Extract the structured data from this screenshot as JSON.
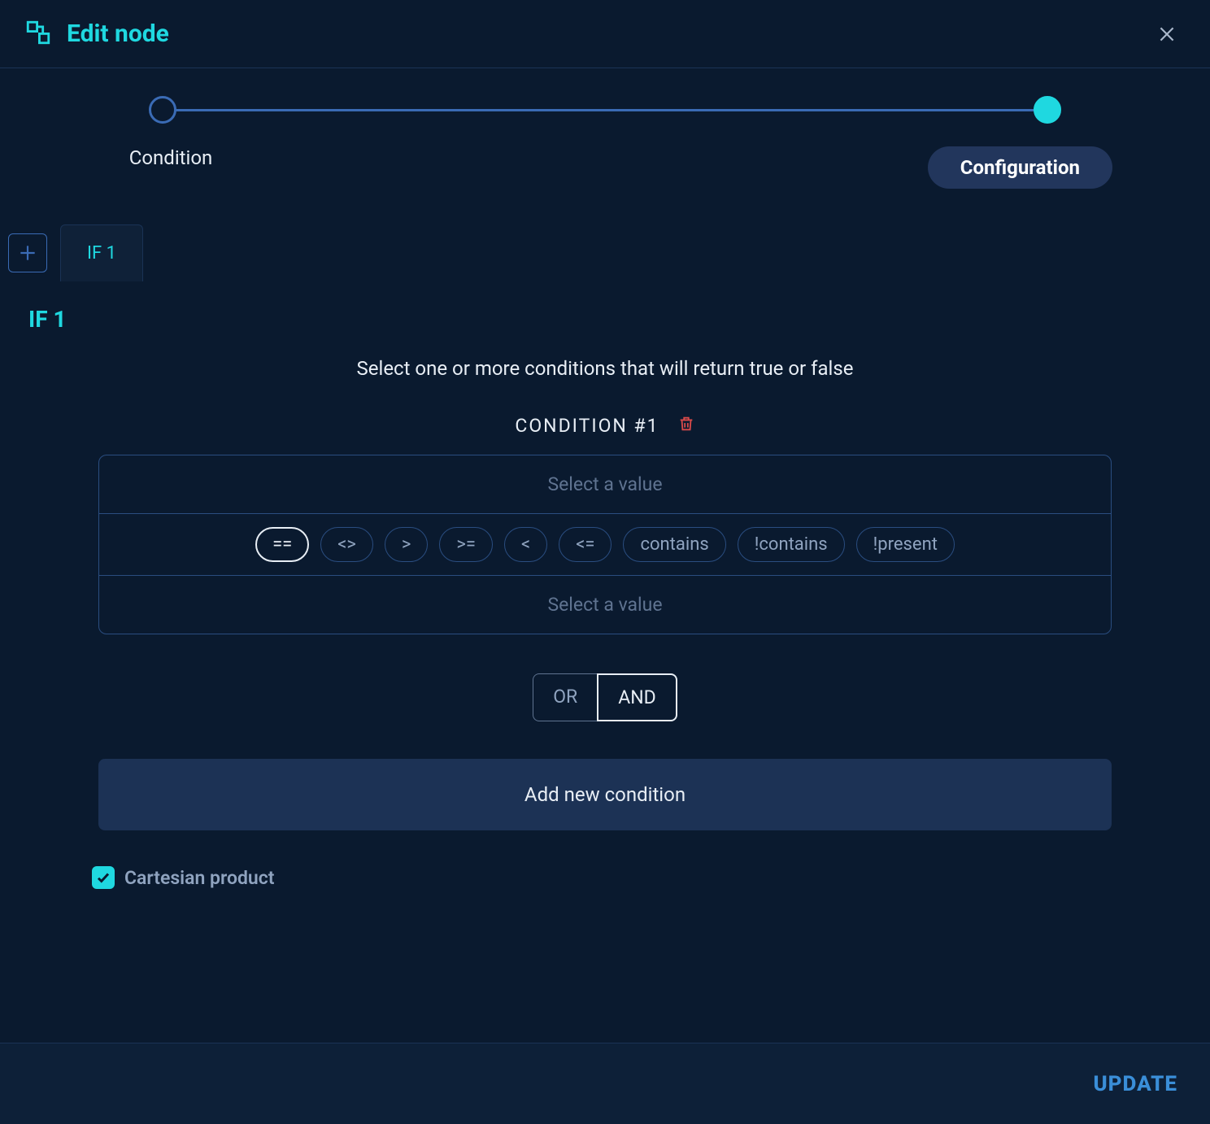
{
  "header": {
    "title": "Edit node"
  },
  "steps": {
    "condition_label": "Condition",
    "configuration_label": "Configuration"
  },
  "tabs": {
    "items": [
      {
        "label": "IF 1"
      }
    ]
  },
  "section": {
    "title": "IF 1",
    "instructions": "Select one or more conditions that will return true or false"
  },
  "condition": {
    "header": "CONDITION  #1",
    "placeholder": "Select a value",
    "operators": [
      {
        "label": "==",
        "selected": true
      },
      {
        "label": "<>",
        "selected": false
      },
      {
        "label": ">",
        "selected": false
      },
      {
        "label": ">=",
        "selected": false
      },
      {
        "label": "<",
        "selected": false
      },
      {
        "label": "<=",
        "selected": false
      },
      {
        "label": "contains",
        "selected": false
      },
      {
        "label": "!contains",
        "selected": false
      },
      {
        "label": "!present",
        "selected": false
      }
    ]
  },
  "logic": {
    "or_label": "OR",
    "and_label": "AND",
    "selected": "AND"
  },
  "add_condition_label": "Add new condition",
  "cartesian": {
    "label": "Cartesian product",
    "checked": true
  },
  "footer": {
    "update_label": "UPDATE"
  }
}
